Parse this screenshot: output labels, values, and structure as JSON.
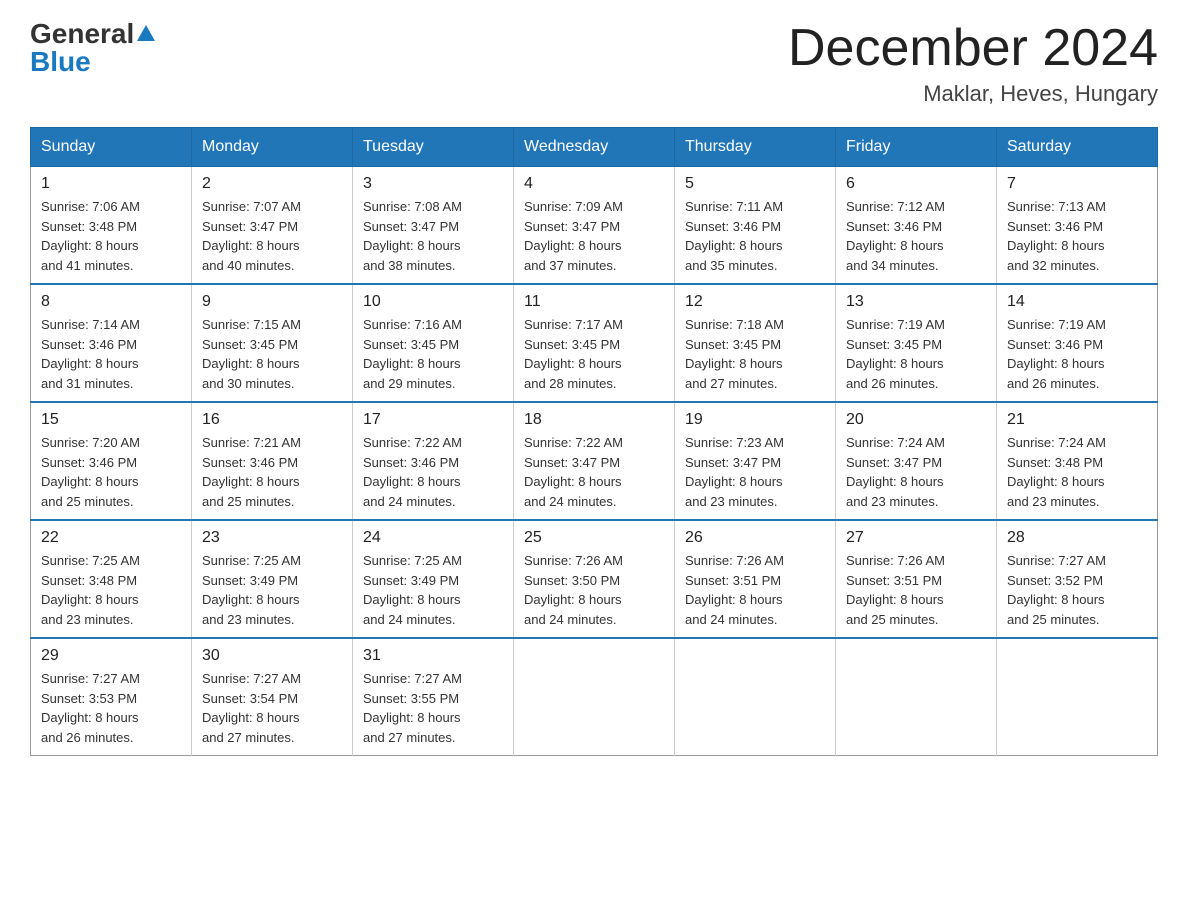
{
  "header": {
    "logo_general": "General",
    "logo_blue": "Blue",
    "title": "December 2024",
    "subtitle": "Maklar, Heves, Hungary"
  },
  "calendar": {
    "days_of_week": [
      "Sunday",
      "Monday",
      "Tuesday",
      "Wednesday",
      "Thursday",
      "Friday",
      "Saturday"
    ],
    "weeks": [
      [
        {
          "date": "1",
          "sunrise": "7:06 AM",
          "sunset": "3:48 PM",
          "daylight": "8 hours and 41 minutes."
        },
        {
          "date": "2",
          "sunrise": "7:07 AM",
          "sunset": "3:47 PM",
          "daylight": "8 hours and 40 minutes."
        },
        {
          "date": "3",
          "sunrise": "7:08 AM",
          "sunset": "3:47 PM",
          "daylight": "8 hours and 38 minutes."
        },
        {
          "date": "4",
          "sunrise": "7:09 AM",
          "sunset": "3:47 PM",
          "daylight": "8 hours and 37 minutes."
        },
        {
          "date": "5",
          "sunrise": "7:11 AM",
          "sunset": "3:46 PM",
          "daylight": "8 hours and 35 minutes."
        },
        {
          "date": "6",
          "sunrise": "7:12 AM",
          "sunset": "3:46 PM",
          "daylight": "8 hours and 34 minutes."
        },
        {
          "date": "7",
          "sunrise": "7:13 AM",
          "sunset": "3:46 PM",
          "daylight": "8 hours and 32 minutes."
        }
      ],
      [
        {
          "date": "8",
          "sunrise": "7:14 AM",
          "sunset": "3:46 PM",
          "daylight": "8 hours and 31 minutes."
        },
        {
          "date": "9",
          "sunrise": "7:15 AM",
          "sunset": "3:45 PM",
          "daylight": "8 hours and 30 minutes."
        },
        {
          "date": "10",
          "sunrise": "7:16 AM",
          "sunset": "3:45 PM",
          "daylight": "8 hours and 29 minutes."
        },
        {
          "date": "11",
          "sunrise": "7:17 AM",
          "sunset": "3:45 PM",
          "daylight": "8 hours and 28 minutes."
        },
        {
          "date": "12",
          "sunrise": "7:18 AM",
          "sunset": "3:45 PM",
          "daylight": "8 hours and 27 minutes."
        },
        {
          "date": "13",
          "sunrise": "7:19 AM",
          "sunset": "3:45 PM",
          "daylight": "8 hours and 26 minutes."
        },
        {
          "date": "14",
          "sunrise": "7:19 AM",
          "sunset": "3:46 PM",
          "daylight": "8 hours and 26 minutes."
        }
      ],
      [
        {
          "date": "15",
          "sunrise": "7:20 AM",
          "sunset": "3:46 PM",
          "daylight": "8 hours and 25 minutes."
        },
        {
          "date": "16",
          "sunrise": "7:21 AM",
          "sunset": "3:46 PM",
          "daylight": "8 hours and 25 minutes."
        },
        {
          "date": "17",
          "sunrise": "7:22 AM",
          "sunset": "3:46 PM",
          "daylight": "8 hours and 24 minutes."
        },
        {
          "date": "18",
          "sunrise": "7:22 AM",
          "sunset": "3:47 PM",
          "daylight": "8 hours and 24 minutes."
        },
        {
          "date": "19",
          "sunrise": "7:23 AM",
          "sunset": "3:47 PM",
          "daylight": "8 hours and 23 minutes."
        },
        {
          "date": "20",
          "sunrise": "7:24 AM",
          "sunset": "3:47 PM",
          "daylight": "8 hours and 23 minutes."
        },
        {
          "date": "21",
          "sunrise": "7:24 AM",
          "sunset": "3:48 PM",
          "daylight": "8 hours and 23 minutes."
        }
      ],
      [
        {
          "date": "22",
          "sunrise": "7:25 AM",
          "sunset": "3:48 PM",
          "daylight": "8 hours and 23 minutes."
        },
        {
          "date": "23",
          "sunrise": "7:25 AM",
          "sunset": "3:49 PM",
          "daylight": "8 hours and 23 minutes."
        },
        {
          "date": "24",
          "sunrise": "7:25 AM",
          "sunset": "3:49 PM",
          "daylight": "8 hours and 24 minutes."
        },
        {
          "date": "25",
          "sunrise": "7:26 AM",
          "sunset": "3:50 PM",
          "daylight": "8 hours and 24 minutes."
        },
        {
          "date": "26",
          "sunrise": "7:26 AM",
          "sunset": "3:51 PM",
          "daylight": "8 hours and 24 minutes."
        },
        {
          "date": "27",
          "sunrise": "7:26 AM",
          "sunset": "3:51 PM",
          "daylight": "8 hours and 25 minutes."
        },
        {
          "date": "28",
          "sunrise": "7:27 AM",
          "sunset": "3:52 PM",
          "daylight": "8 hours and 25 minutes."
        }
      ],
      [
        {
          "date": "29",
          "sunrise": "7:27 AM",
          "sunset": "3:53 PM",
          "daylight": "8 hours and 26 minutes."
        },
        {
          "date": "30",
          "sunrise": "7:27 AM",
          "sunset": "3:54 PM",
          "daylight": "8 hours and 27 minutes."
        },
        {
          "date": "31",
          "sunrise": "7:27 AM",
          "sunset": "3:55 PM",
          "daylight": "8 hours and 27 minutes."
        },
        null,
        null,
        null,
        null
      ]
    ]
  }
}
